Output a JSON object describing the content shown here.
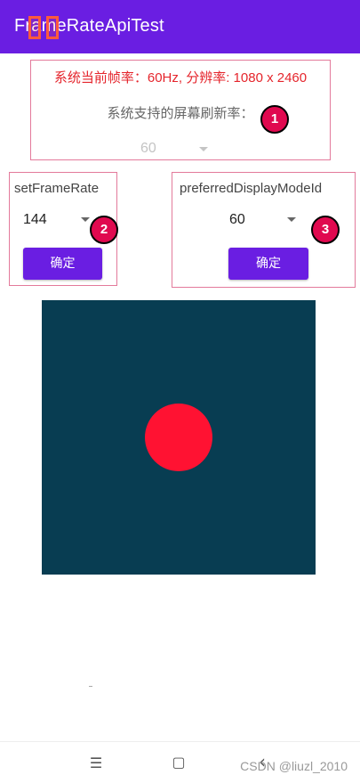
{
  "app": {
    "title": "FrameRateApiTest"
  },
  "info": {
    "current_text": "系统当前帧率：60Hz, 分辨率: 1080 x 2460",
    "supported_label": "系统支持的屏幕刷新率：",
    "supported_value": "60"
  },
  "annotations": {
    "badge1": "1",
    "badge2": "2",
    "badge3": "3"
  },
  "set_frame_rate": {
    "title": "setFrameRate",
    "value": "144",
    "confirm_label": "确定"
  },
  "preferred_mode": {
    "title": "preferredDisplayModeId",
    "value": "60",
    "confirm_label": "确定"
  },
  "navbar": {
    "menu_icon": "☰",
    "home_icon": "▢",
    "back_icon": "‹"
  },
  "watermark": "CSDN @liuzl_2010",
  "colors": {
    "accent": "#6a1ee2",
    "canvas": "#083d52",
    "ball": "#ff1232",
    "badge": "#e0094f",
    "info_text": "#e5252c"
  }
}
